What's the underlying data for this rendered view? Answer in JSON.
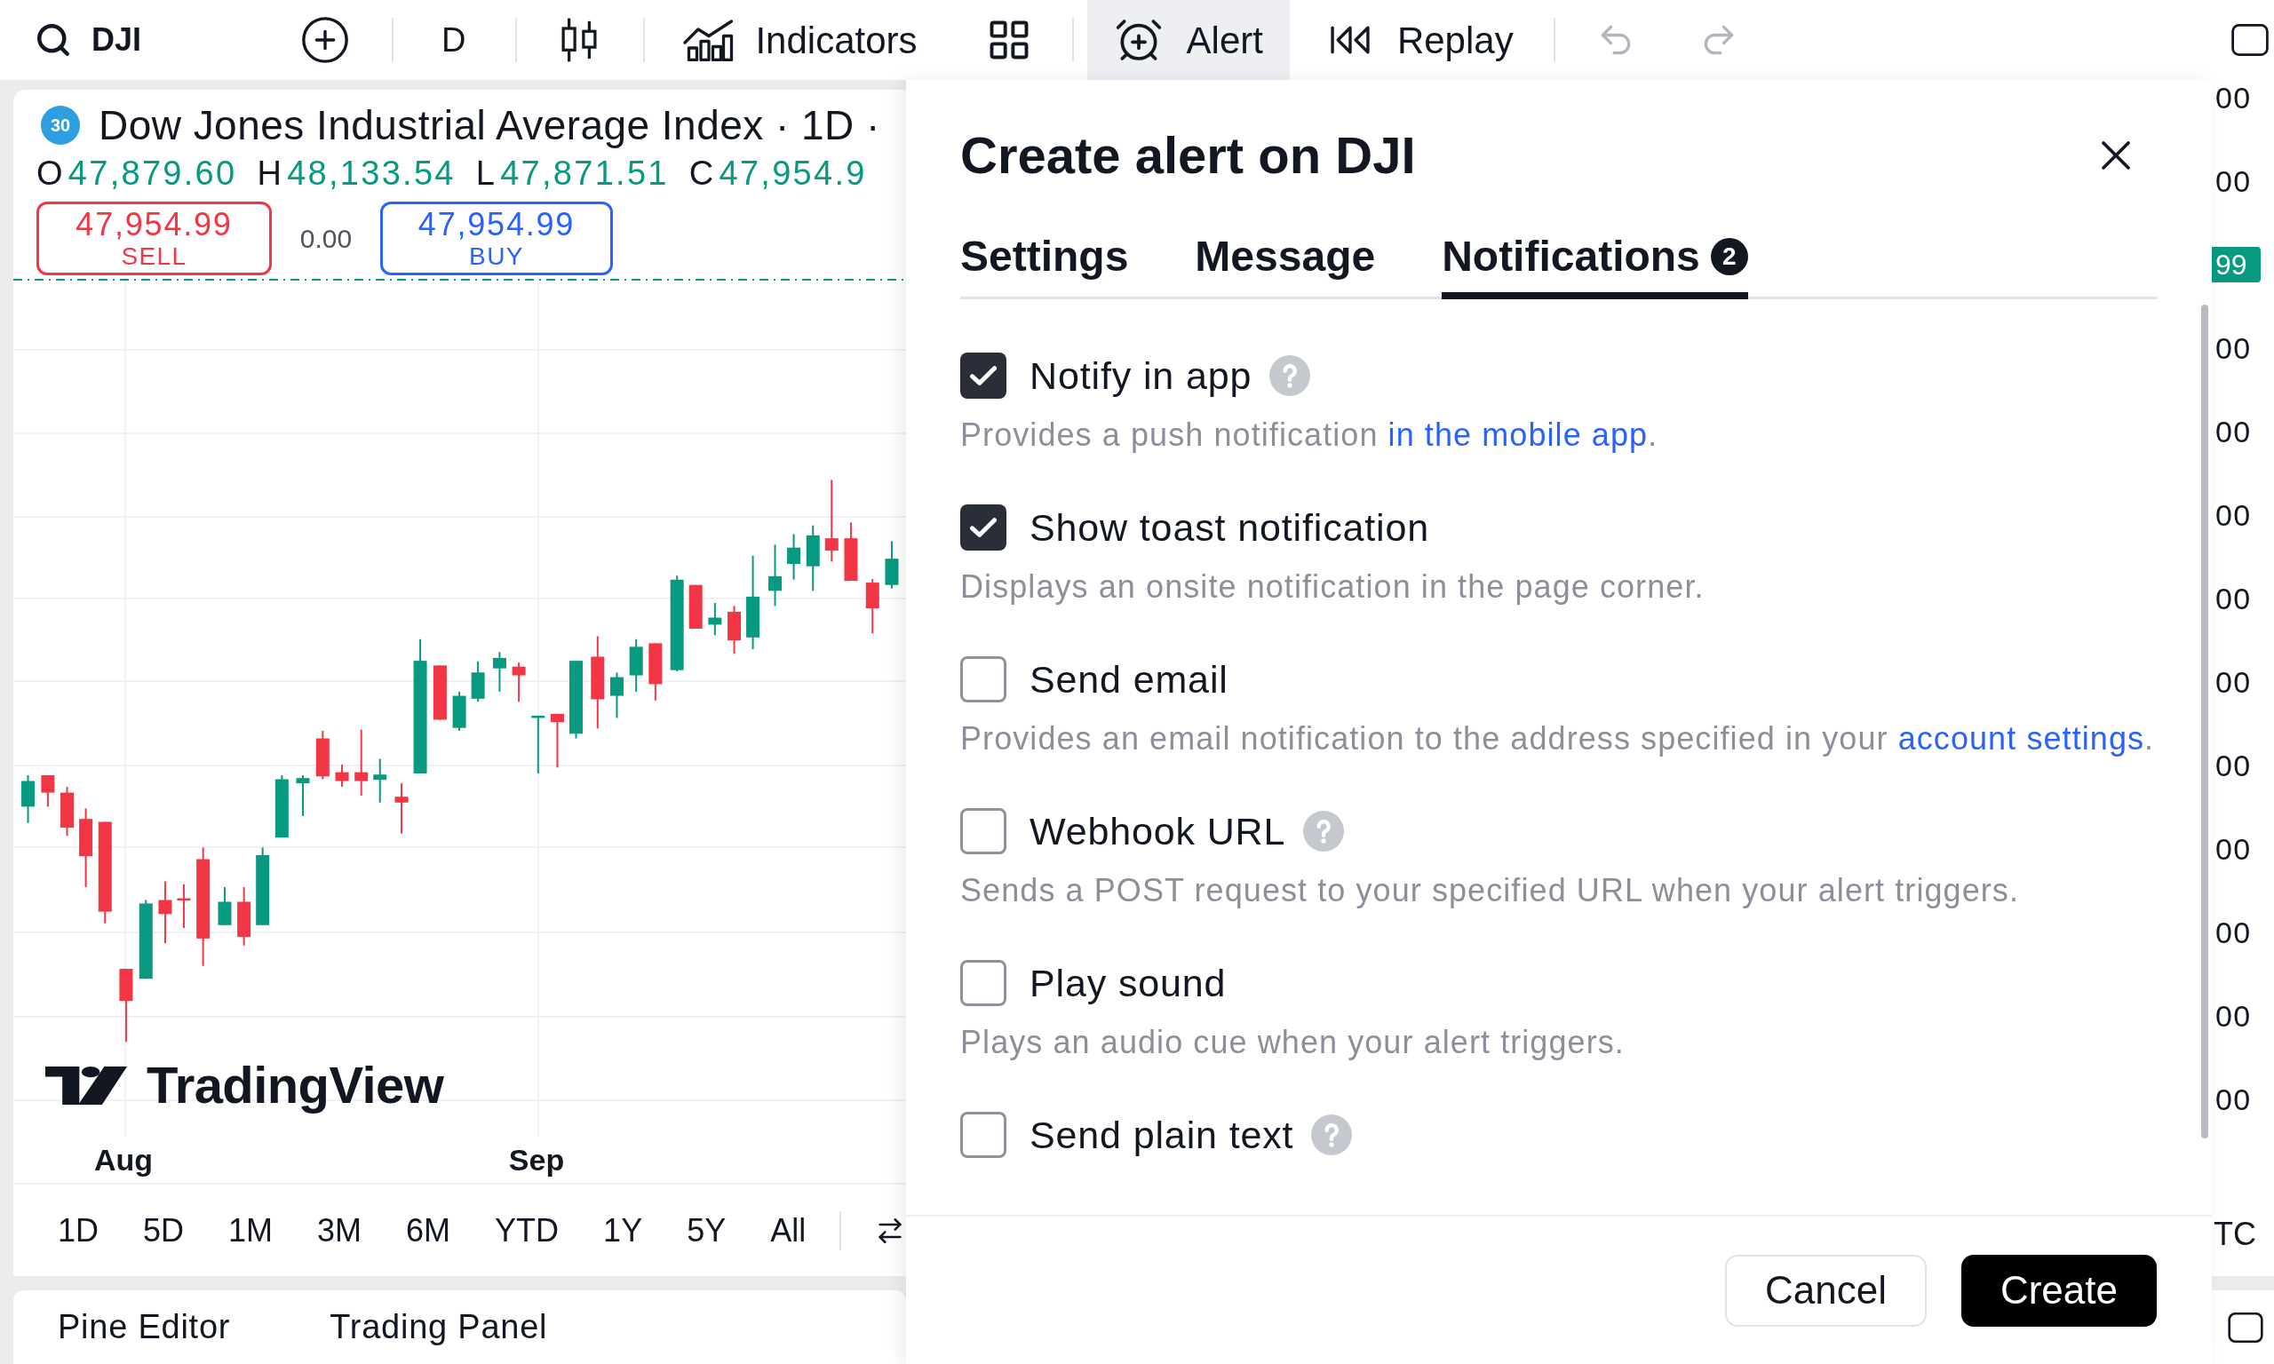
{
  "toolbar": {
    "symbol": "DJI",
    "interval": "D",
    "indicators": {
      "label": "Indicators"
    },
    "alert": {
      "label": "Alert",
      "active": true
    },
    "replay": {
      "label": "Replay"
    },
    "undo": {
      "disabled": true
    },
    "redo": {
      "disabled": true
    }
  },
  "chart": {
    "badge": "30",
    "title": "Dow Jones Industrial Average Index · 1D ·",
    "ohlc": [
      {
        "label": "O",
        "value": "47,879.60"
      },
      {
        "label": "H",
        "value": "48,133.54"
      },
      {
        "label": "L",
        "value": "47,871.51"
      },
      {
        "label": "C",
        "value": "47,954.9"
      }
    ],
    "sell": {
      "price": "47,954.99",
      "label": "SELL"
    },
    "spread": "0.00",
    "buy": {
      "price": "47,954.99",
      "label": "BUY"
    },
    "logo": "TradingView",
    "time_axis": [
      "Aug",
      "Sep"
    ],
    "price_axis": [
      {
        "kind": "tick",
        "text": "00"
      },
      {
        "kind": "tick",
        "text": "00"
      },
      {
        "kind": "current",
        "text": "99"
      },
      {
        "kind": "tick",
        "text": "00"
      },
      {
        "kind": "tick",
        "text": "00"
      },
      {
        "kind": "tick",
        "text": "00"
      },
      {
        "kind": "tick",
        "text": "00"
      },
      {
        "kind": "tick",
        "text": "00"
      },
      {
        "kind": "tick",
        "text": "00"
      },
      {
        "kind": "tick",
        "text": "00"
      },
      {
        "kind": "tick",
        "text": "00"
      },
      {
        "kind": "tick",
        "text": "00"
      },
      {
        "kind": "tick",
        "text": "00"
      }
    ],
    "timezone": "TC"
  },
  "periods": [
    "1D",
    "5D",
    "1M",
    "3M",
    "6M",
    "YTD",
    "1Y",
    "5Y",
    "All"
  ],
  "bottom_tabs": [
    "Pine Editor",
    "Trading Panel"
  ],
  "alert_dialog": {
    "title": "Create alert on DJI",
    "tabs": [
      {
        "label": "Settings",
        "selected": false
      },
      {
        "label": "Message",
        "selected": false
      },
      {
        "label": "Notifications",
        "selected": true,
        "count": "2"
      }
    ],
    "options": [
      {
        "label": "Notify in app",
        "checked": true,
        "help": true,
        "description": [
          {
            "kind": "text",
            "text": "Provides a push notification "
          },
          {
            "kind": "link",
            "text": "in the mobile app"
          },
          {
            "kind": "text",
            "text": "."
          }
        ]
      },
      {
        "label": "Show toast notification",
        "checked": true,
        "help": false,
        "description": [
          {
            "kind": "text",
            "text": "Displays an onsite notification in the page corner."
          }
        ]
      },
      {
        "label": "Send email",
        "checked": false,
        "help": false,
        "description": [
          {
            "kind": "text",
            "text": "Provides an email notification to the address specified in your "
          },
          {
            "kind": "link",
            "text": "account settings"
          },
          {
            "kind": "text",
            "text": "."
          }
        ]
      },
      {
        "label": "Webhook URL",
        "checked": false,
        "help": true,
        "description": [
          {
            "kind": "text",
            "text": "Sends a POST request to your specified URL when your alert triggers."
          }
        ]
      },
      {
        "label": "Play sound",
        "checked": false,
        "help": false,
        "description": [
          {
            "kind": "text",
            "text": "Plays an audio cue when your alert triggers."
          }
        ]
      },
      {
        "label": "Send plain text",
        "checked": false,
        "help": true
      }
    ],
    "buttons": [
      {
        "label": "Cancel",
        "kind": "secondary"
      },
      {
        "label": "Create",
        "kind": "primary"
      }
    ]
  }
}
